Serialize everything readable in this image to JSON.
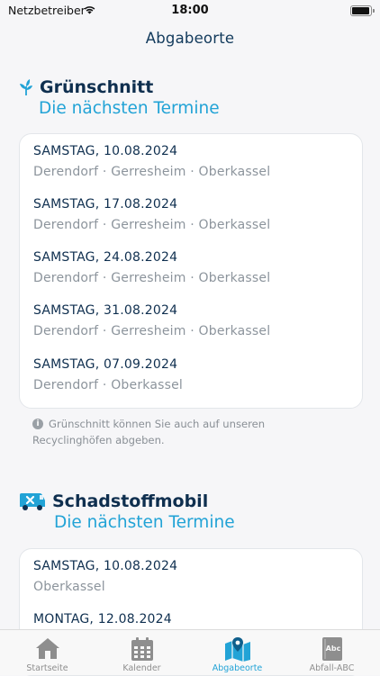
{
  "status": {
    "carrier": "Netzbetreiber",
    "time": "18:00",
    "battery_level": 0.95
  },
  "header": {
    "title": "Abgabeorte"
  },
  "gruenschnitt": {
    "title": "Grünschnitt",
    "subtitle": "Die nächsten Termine",
    "entries": [
      {
        "date": "SAMSTAG, 10.08.2024",
        "places": "Derendorf · Gerresheim · Oberkassel"
      },
      {
        "date": "SAMSTAG, 17.08.2024",
        "places": "Derendorf · Gerresheim · Oberkassel"
      },
      {
        "date": "SAMSTAG, 24.08.2024",
        "places": "Derendorf · Gerresheim · Oberkassel"
      },
      {
        "date": "SAMSTAG, 31.08.2024",
        "places": "Derendorf · Gerresheim · Oberkassel"
      },
      {
        "date": "SAMSTAG, 07.09.2024",
        "places": "Derendorf · Oberkassel"
      }
    ],
    "note": "Grünschnitt können Sie auch auf unseren Recyclinghöfen abgeben."
  },
  "schadstoffmobil": {
    "title": "Schadstoffmobil",
    "subtitle": "Die nächsten Termine",
    "entries": [
      {
        "date": "SAMSTAG, 10.08.2024",
        "places": "Oberkassel"
      },
      {
        "date": "MONTAG, 12.08.2024",
        "places": ""
      }
    ]
  },
  "tabs": [
    {
      "label": "Startseite",
      "icon": "home-icon",
      "active": false
    },
    {
      "label": "Kalender",
      "icon": "calendar-icon",
      "active": false
    },
    {
      "label": "Abgabeorte",
      "icon": "map-pin-icon",
      "active": true
    },
    {
      "label": "Abfall-ABC",
      "icon": "abc-book-icon",
      "active": false
    }
  ],
  "colors": {
    "accent": "#22a3d6",
    "text_dark": "#0f2f4f",
    "text_muted": "#8c949c",
    "tab_inactive": "#8e8e8e"
  }
}
